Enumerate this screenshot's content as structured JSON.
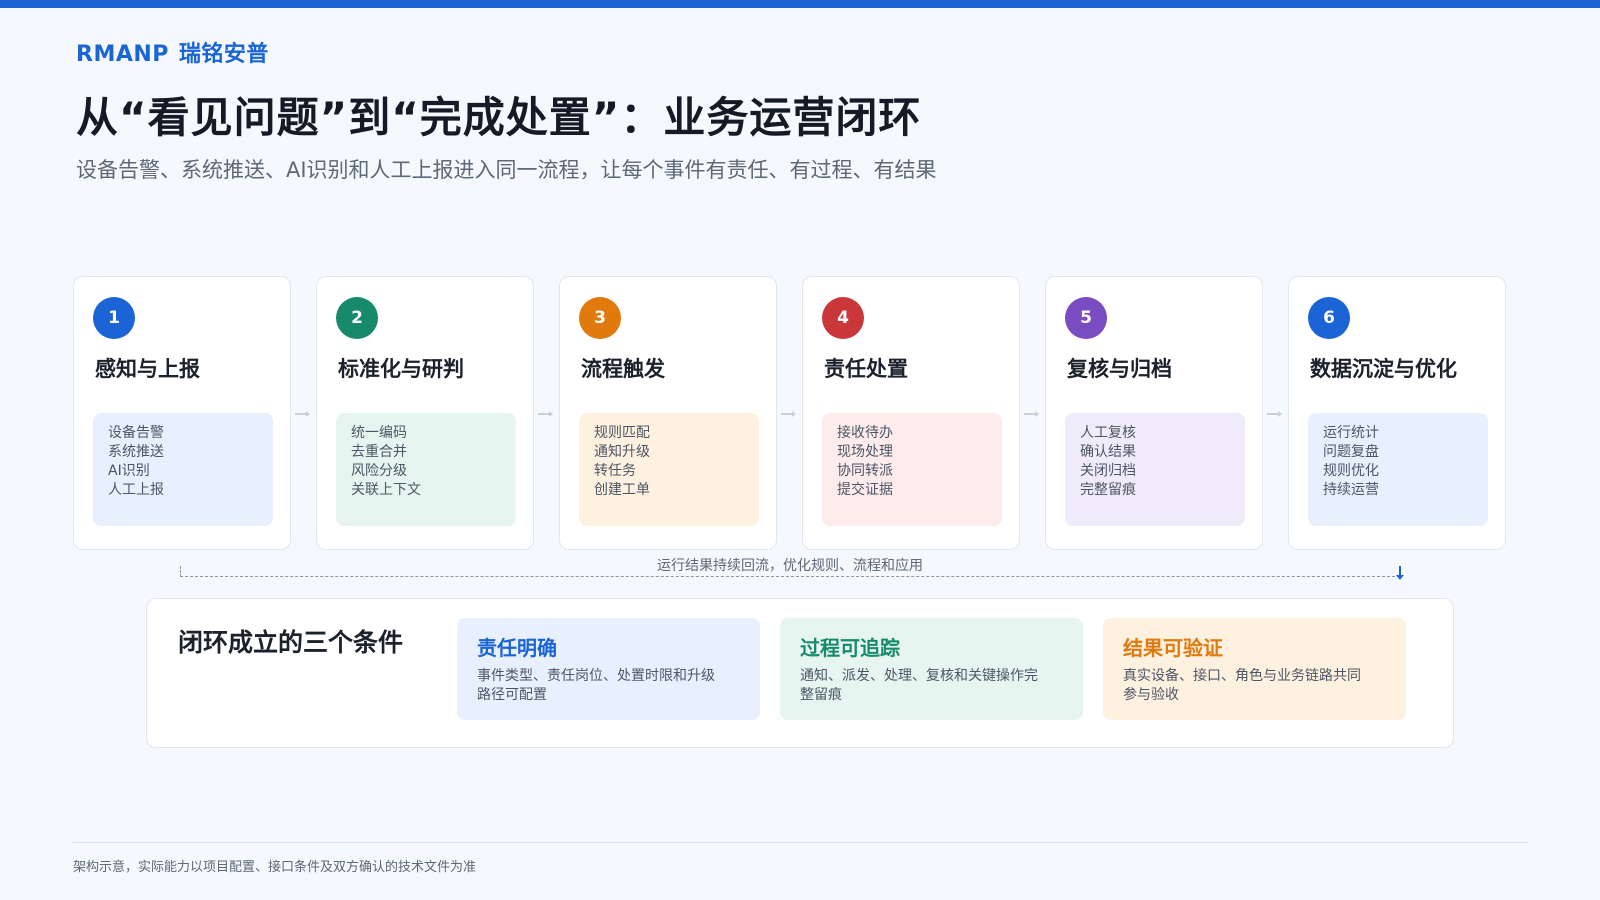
{
  "brand": {
    "latin": "RMANP",
    "cn": "瑞铭安普"
  },
  "title": "从“看见问题”到“完成处置”：业务运营闭环",
  "subtitle": "设备告警、系统推送、AI识别和人工上报进入同一流程，让每个事件有责任、有过程、有结果",
  "steps": [
    {
      "num": "1",
      "name": "感知与上报",
      "items": [
        "设备告警",
        "系统推送",
        "AI识别",
        "人工上报"
      ],
      "accent": "#1a64d6",
      "tint": "#e8f0fd"
    },
    {
      "num": "2",
      "name": "标准化与研判",
      "items": [
        "统一编码",
        "去重合并",
        "风险分级",
        "关联上下文"
      ],
      "accent": "#168a6a",
      "tint": "#e6f5ef"
    },
    {
      "num": "3",
      "name": "流程触发",
      "items": [
        "规则匹配",
        "通知升级",
        "转任务",
        "创建工单"
      ],
      "accent": "#e07a0c",
      "tint": "#fef1e0"
    },
    {
      "num": "4",
      "name": "责任处置",
      "items": [
        "接收待办",
        "现场处理",
        "协同转派",
        "提交证据"
      ],
      "accent": "#c9373a",
      "tint": "#fdeceb"
    },
    {
      "num": "5",
      "name": "复核与归档",
      "items": [
        "人工复核",
        "确认结果",
        "关闭归档",
        "完整留痕"
      ],
      "accent": "#7a4cc2",
      "tint": "#f0ebfb"
    },
    {
      "num": "6",
      "name": "数据沉淀与优化",
      "items": [
        "运行统计",
        "问题复盘",
        "规则优化",
        "持续运营"
      ],
      "accent": "#1a64d6",
      "tint": "#e8f0fd"
    }
  ],
  "feedback": {
    "label": "运行结果持续回流，优化规则、流程和应用"
  },
  "conditions": {
    "heading": "闭环成立的三个条件",
    "items": [
      {
        "title": "责任明确",
        "desc": "事件类型、责任岗位、处置时限和升级路径可配置",
        "accent": "#1a64d6",
        "tint": "#e8f0fd"
      },
      {
        "title": "过程可追踪",
        "desc": "通知、派发、处理、复核和关键操作完整留痕",
        "accent": "#168a6a",
        "tint": "#e6f5ef"
      },
      {
        "title": "结果可验证",
        "desc": "真实设备、接口、角色与业务链路共同参与验收",
        "accent": "#e07a0c",
        "tint": "#fef1e0"
      }
    ]
  },
  "footnote": "架构示意，实际能力以项目配置、接口条件及双方确认的技术文件为准"
}
